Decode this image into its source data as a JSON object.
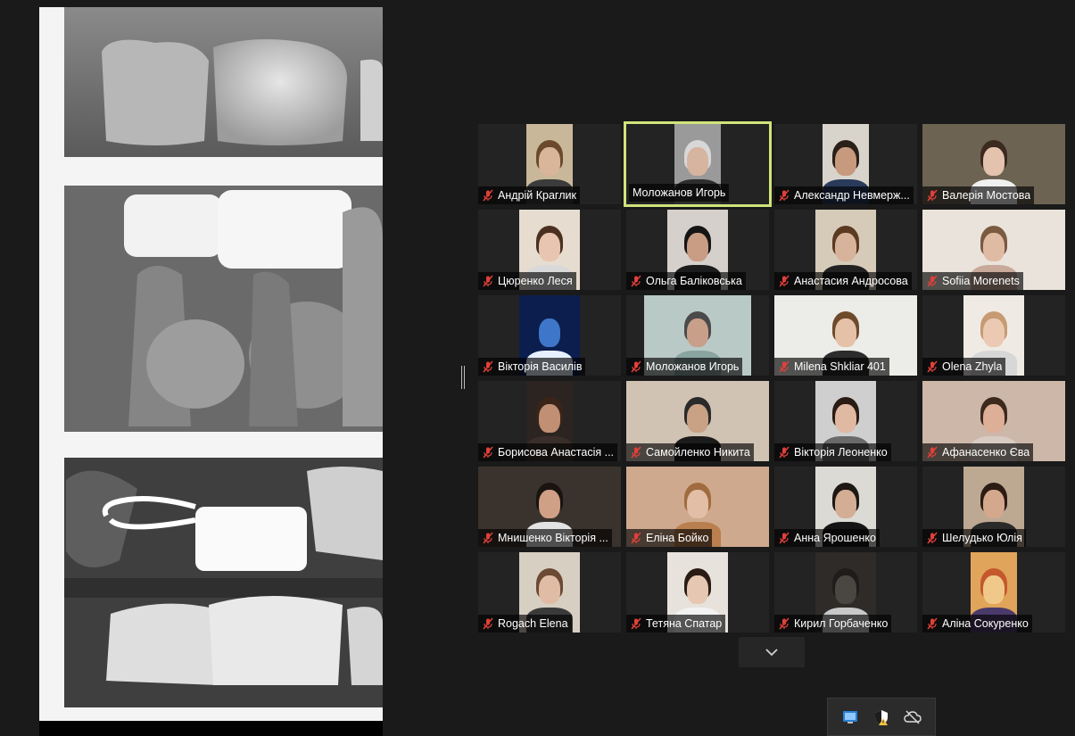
{
  "shared_screen": {
    "content": "dental x-ray image",
    "icon": "radiograph"
  },
  "gallery": {
    "participants": [
      {
        "name": "Андрій Краглик",
        "muted": true,
        "active": false
      },
      {
        "name": "Моложанов Игорь",
        "muted": false,
        "active": true
      },
      {
        "name": "Александр Невмерж...",
        "muted": true,
        "active": false
      },
      {
        "name": "Валерія Мостова",
        "muted": true,
        "active": false
      },
      {
        "name": "Цюренко Леся",
        "muted": true,
        "active": false
      },
      {
        "name": "Ольга Баліковська",
        "muted": true,
        "active": false
      },
      {
        "name": "Анастасия Андросова",
        "muted": true,
        "active": false
      },
      {
        "name": "Sofiia Morenets",
        "muted": true,
        "active": false
      },
      {
        "name": "Вікторія Василів",
        "muted": true,
        "active": false
      },
      {
        "name": "Моложанов Игорь",
        "muted": true,
        "active": false
      },
      {
        "name": "Milena Shkliar 401",
        "muted": true,
        "active": false
      },
      {
        "name": "Olena Zhyla",
        "muted": true,
        "active": false
      },
      {
        "name": "Борисова Анастасія ...",
        "muted": true,
        "active": false
      },
      {
        "name": "Самойленко Никита",
        "muted": true,
        "active": false
      },
      {
        "name": "Вікторія Леоненко",
        "muted": true,
        "active": false
      },
      {
        "name": "Афанасенко Єва",
        "muted": true,
        "active": false
      },
      {
        "name": "Мнишенко Вікторія ...",
        "muted": true,
        "active": false
      },
      {
        "name": "Еліна Бойко",
        "muted": true,
        "active": false
      },
      {
        "name": "Анна Ярошенко",
        "muted": true,
        "active": false
      },
      {
        "name": "Шелудько Юлія",
        "muted": true,
        "active": false
      },
      {
        "name": "Rogach Elena",
        "muted": true,
        "active": false
      },
      {
        "name": "Тетяна Спатар",
        "muted": true,
        "active": false
      },
      {
        "name": "Кирил Горбаченко",
        "muted": true,
        "active": false
      },
      {
        "name": "Аліна Сокуренко",
        "muted": true,
        "active": false
      }
    ],
    "more_button_icon": "chevron-down-icon"
  },
  "tray": {
    "icons": [
      "network-icon",
      "security-warning-icon",
      "cloud-offline-icon"
    ]
  },
  "colors": {
    "background": "#1a1a1a",
    "tile": "#232323",
    "active_speaker": "#cfe47a",
    "muted_icon": "#e0403a"
  }
}
